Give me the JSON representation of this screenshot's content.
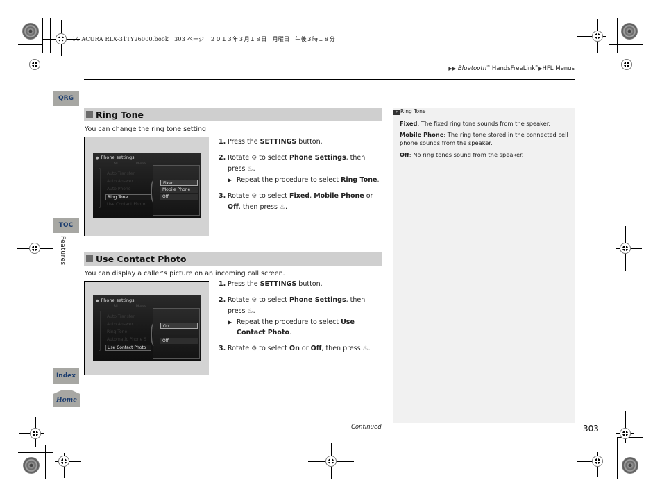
{
  "printer_line": "14 ACURA RLX-31TY26000.book　303 ページ　２０１３年３月１８日　月曜日　午後３時１８分",
  "breadcrumb": {
    "arrows": "▶▶",
    "part1": "Bluetooth",
    "reg1": "®",
    "part2": " HandsFreeLink",
    "reg2": "®",
    "arrow2": "▶",
    "part3": "HFL Menus"
  },
  "side_tabs": {
    "qrg": "QRG",
    "toc": "TOC",
    "index": "Index",
    "home": "Home"
  },
  "chapter_label": "Features",
  "sections": [
    {
      "title": "Ring Tone",
      "intro": "You can change the ring tone setting.",
      "screen": {
        "title": "Phone settings",
        "tabs": [
          "All",
          "Phone"
        ],
        "menu_items": [
          "Auto Transfer",
          "Auto Answer",
          "Auto Phone",
          "Ring Tone",
          "Use Contact Photo"
        ],
        "selected_item": "Ring Tone",
        "options": [
          "Fixed",
          "Mobile Phone",
          "Off"
        ],
        "selected_option": "Fixed"
      },
      "steps": [
        {
          "num": "1.",
          "pre": "Press the ",
          "b1": "SETTINGS",
          "post": " button."
        },
        {
          "num": "2.",
          "pre": "Rotate ",
          "knob": "⚙",
          "mid": " to select ",
          "b1": "Phone Settings",
          "post": ", then press ",
          "press": "♨",
          "end": ".",
          "sub_arrow": "▶",
          "sub_pre": "Repeat the procedure to select ",
          "sub_b": "Ring Tone",
          "sub_end": "."
        },
        {
          "num": "3.",
          "pre": "Rotate ",
          "knob": "⚙",
          "mid": " to select ",
          "b1": "Fixed",
          "sep1": ", ",
          "b2": "Mobile Phone",
          "sep2": " or ",
          "b3": "Off",
          "post": ", then press ",
          "press": "♨",
          "end": "."
        }
      ]
    },
    {
      "title": "Use Contact Photo",
      "intro": "You can display a caller’s picture on an incoming call screen.",
      "screen": {
        "title": "Phone settings",
        "tabs": [
          "All",
          "Phone"
        ],
        "menu_items": [
          "Auto Transfer",
          "Auto Answer",
          "Ring Tone",
          "Automatic Phone S",
          "Use Contact Photo"
        ],
        "selected_item": "Use Contact Photo",
        "options": [
          "On",
          "Off"
        ],
        "selected_option": "On"
      },
      "steps": [
        {
          "num": "1.",
          "pre": "Press the ",
          "b1": "SETTINGS",
          "post": " button."
        },
        {
          "num": "2.",
          "pre": "Rotate ",
          "knob": "⚙",
          "mid": " to select ",
          "b1": "Phone Settings",
          "post": ", then press ",
          "press": "♨",
          "end": ".",
          "sub_arrow": "▶",
          "sub_pre": "Repeat the procedure to select ",
          "sub_b": "Use Contact Photo",
          "sub_end": "."
        },
        {
          "num": "3.",
          "pre": "Rotate ",
          "knob": "⚙",
          "mid": " to select ",
          "b1": "On",
          "sep1": " or ",
          "b2": "Off",
          "post": ", then press ",
          "press": "♨",
          "end": "."
        }
      ]
    }
  ],
  "side_note": {
    "ref_icon": "»",
    "heading": "Ring Tone",
    "items": [
      {
        "term": "Fixed",
        "text": ": The fixed ring tone sounds from the speaker."
      },
      {
        "term": "Mobile Phone",
        "text": ": The ring tone stored in the connected cell phone sounds from the speaker."
      },
      {
        "term": "Off",
        "text": ": No ring tones sound from the speaker."
      }
    ]
  },
  "footer": {
    "continued": "Continued",
    "page_number": "303"
  }
}
